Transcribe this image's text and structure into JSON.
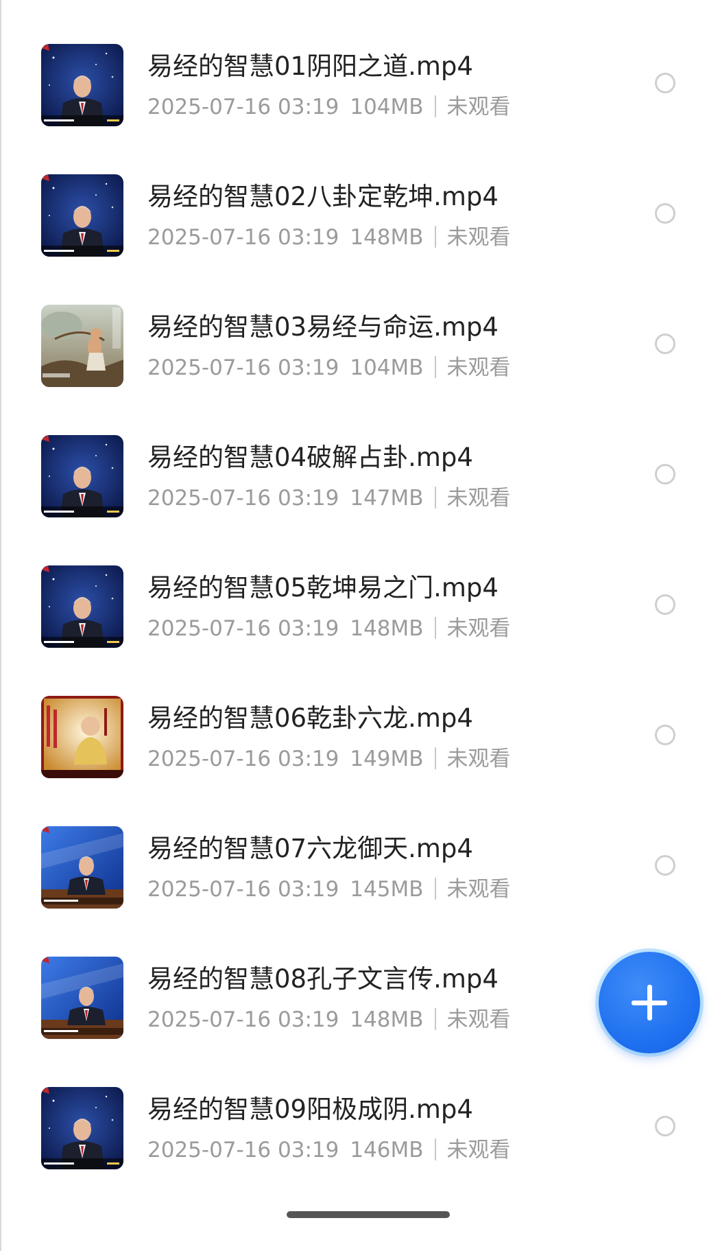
{
  "files": [
    {
      "title": "易经的智慧01阴阳之道.mp4",
      "date": "2025-07-16 03:19",
      "size": "104MB",
      "status": "未观看",
      "thumb_style": "studio-blue"
    },
    {
      "title": "易经的智慧02八卦定乾坤.mp4",
      "date": "2025-07-16 03:19",
      "size": "148MB",
      "status": "未观看",
      "thumb_style": "studio-blue"
    },
    {
      "title": "易经的智慧03易经与命运.mp4",
      "date": "2025-07-16 03:19",
      "size": "104MB",
      "status": "未观看",
      "thumb_style": "painting"
    },
    {
      "title": "易经的智慧04破解占卦.mp4",
      "date": "2025-07-16 03:19",
      "size": "147MB",
      "status": "未观看",
      "thumb_style": "studio-blue"
    },
    {
      "title": "易经的智慧05乾坤易之门.mp4",
      "date": "2025-07-16 03:19",
      "size": "148MB",
      "status": "未观看",
      "thumb_style": "studio-blue"
    },
    {
      "title": "易经的智慧06乾卦六龙.mp4",
      "date": "2025-07-16 03:19",
      "size": "149MB",
      "status": "未观看",
      "thumb_style": "title-card-gold"
    },
    {
      "title": "易经的智慧07六龙御天.mp4",
      "date": "2025-07-16 03:19",
      "size": "145MB",
      "status": "未观看",
      "thumb_style": "studio-bright"
    },
    {
      "title": "易经的智慧08孔子文言传.mp4",
      "date": "2025-07-16 03:19",
      "size": "148MB",
      "status": "未观看",
      "thumb_style": "studio-bright"
    },
    {
      "title": "易经的智慧09阳极成阴.mp4",
      "date": "2025-07-16 03:19",
      "size": "146MB",
      "status": "未观看",
      "thumb_style": "studio-blue"
    }
  ],
  "fab": {
    "icon": "plus-icon",
    "color": "#1e6ff0"
  },
  "colors": {
    "title": "#222222",
    "meta": "#9b9b9b",
    "radio_border": "#cfcfcf"
  }
}
